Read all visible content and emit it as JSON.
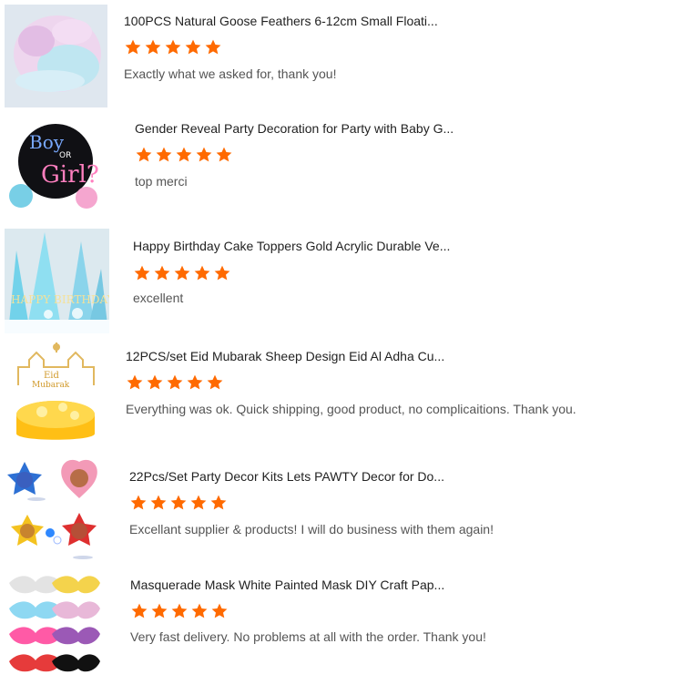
{
  "theme": {
    "star_color": "#ff6a00"
  },
  "reviews": [
    {
      "product_title": "100PCS Natural Goose Feathers 6-12cm Small Floati...",
      "rating": 5,
      "comment": "Exactly what we asked for, thank you!",
      "thumbnail_icon": "feathers-image"
    },
    {
      "product_title": "Gender Reveal Party Decoration for Party with Baby G...",
      "rating": 5,
      "comment": "top merci",
      "thumbnail_icon": "balloon-image",
      "thumbnail_text": {
        "line1": "Boy",
        "line2": "OR",
        "line3": "Girl?"
      }
    },
    {
      "product_title": "Happy Birthday Cake Toppers Gold Acrylic Durable Ve...",
      "rating": 5,
      "comment": "excellent",
      "thumbnail_icon": "cake-topper-image",
      "thumbnail_text": {
        "line1": "HAPPY BIRTHDAY"
      }
    },
    {
      "product_title": "12PCS/set Eid Mubarak Sheep Design Eid Al Adha Cu...",
      "rating": 5,
      "comment": "Everything was ok. Quick shipping, good product, no complicaitions. Thank you.",
      "thumbnail_icon": "eid-cake-image",
      "thumbnail_text": {
        "line1": "Eid",
        "line2": "Mubarak"
      }
    },
    {
      "product_title": "22Pcs/Set Party Decor Kits Lets PAWTY Decor for Do...",
      "rating": 5,
      "comment": "Excellant supplier & products! I will do business with them again!",
      "thumbnail_icon": "pawty-balloons-image"
    },
    {
      "product_title": "Masquerade Mask White Painted Mask DIY Craft Pap...",
      "rating": 5,
      "comment": "Very fast delivery. No problems at all with the order. Thank you!",
      "thumbnail_icon": "masks-image"
    }
  ]
}
